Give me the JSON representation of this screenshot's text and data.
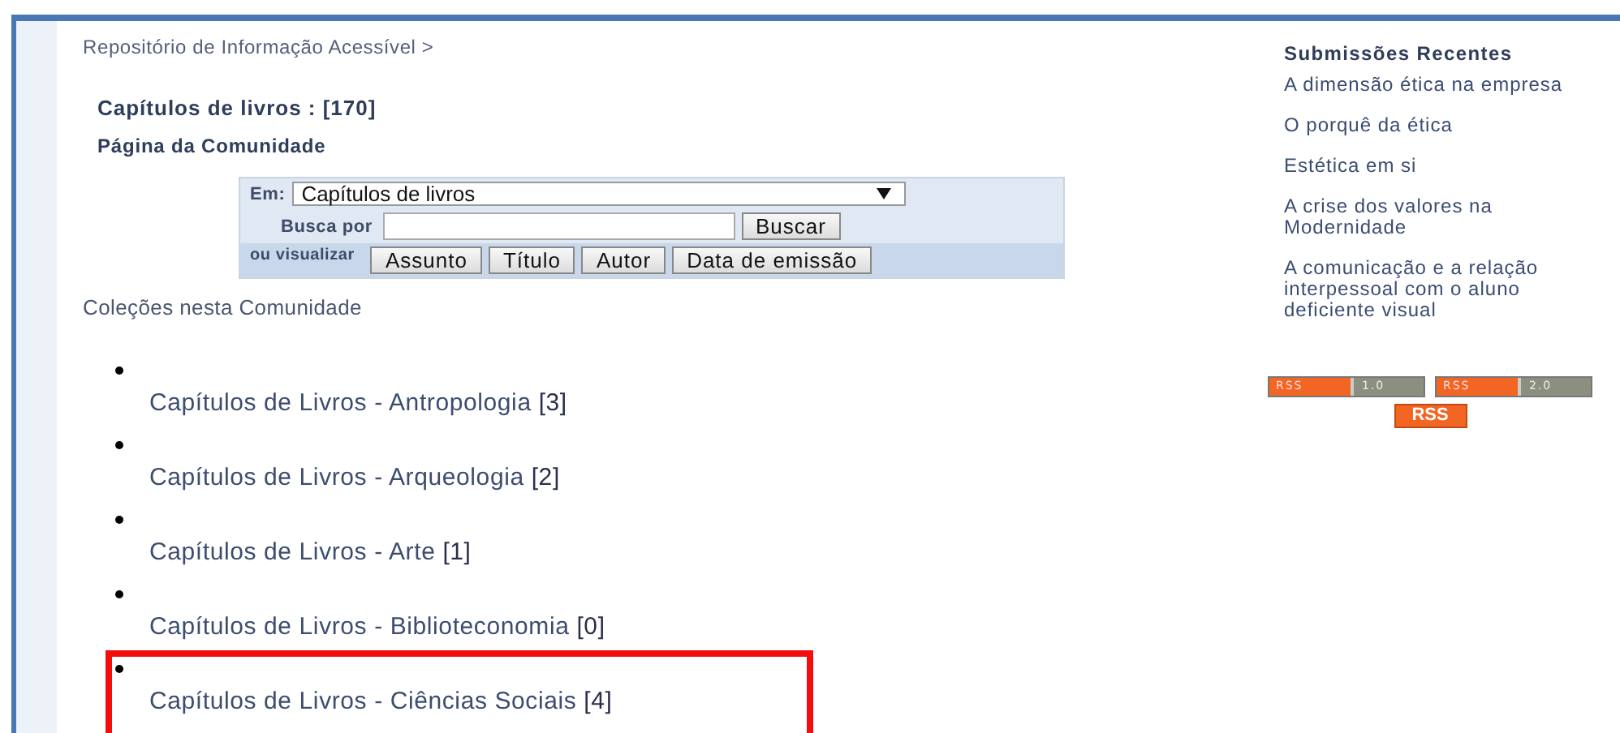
{
  "breadcrumb": "Repositório de Informação Acessível >",
  "community": {
    "title": "Capítulos de livros : [170]",
    "link": "Página da Comunidade"
  },
  "search": {
    "scope_label": "Em:",
    "scope_value": "Capítulos de livros",
    "query_label": "Busca por",
    "search_button": "Buscar",
    "browse_label": "ou visualizar",
    "browse_buttons": [
      "Assunto",
      "Título",
      "Autor",
      "Data de emissão"
    ]
  },
  "collections": {
    "heading": "Coleções nesta Comunidade",
    "items": [
      {
        "name": "Capítulos de Livros - Antropologia",
        "count": "[3]",
        "highlighted": false
      },
      {
        "name": "Capítulos de Livros - Arqueologia",
        "count": "[2]",
        "highlighted": false
      },
      {
        "name": "Capítulos de Livros - Arte",
        "count": "[1]",
        "highlighted": false
      },
      {
        "name": "Capítulos de Livros - Biblioteconomia",
        "count": "[0]",
        "highlighted": false
      },
      {
        "name": "Capítulos de Livros - Ciências Sociais",
        "count": "[4]",
        "highlighted": true
      }
    ]
  },
  "recent_submissions": {
    "heading": "Submissões Recentes",
    "items": [
      "A dimensão ética na empresa",
      "O porquê da ética",
      "Estética em si",
      "A crise dos valores na Modernidade",
      "A comunicação e a relação interpessoal com o aluno deficiente visual"
    ]
  },
  "feeds": [
    {
      "kind": "versioned",
      "label": "RSS",
      "version": "1.0"
    },
    {
      "kind": "versioned",
      "label": "RSS",
      "version": "2.0"
    },
    {
      "kind": "plain",
      "label": "RSS"
    }
  ]
}
